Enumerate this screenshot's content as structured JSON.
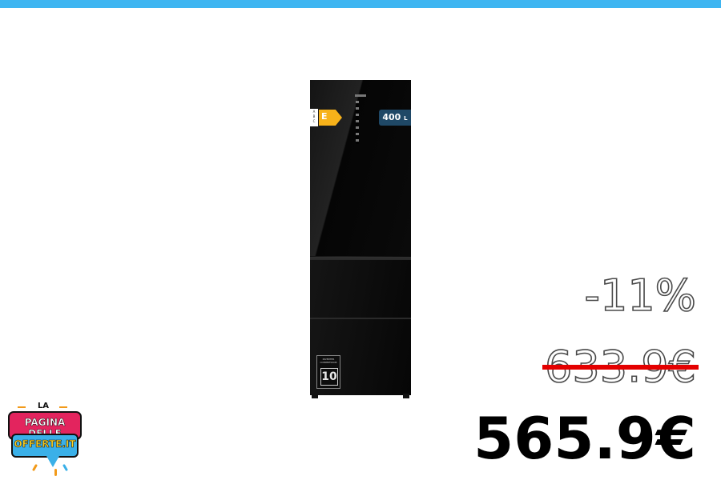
{
  "product": {
    "energy_classes": "A\nB\nC",
    "energy_class": "E",
    "capacity": "400",
    "capacity_unit": "L",
    "inverter_text": "INVERTER\nCOMPRESSOR",
    "inverter_years": "10"
  },
  "pricing": {
    "discount": "-11%",
    "old_price": "633.9€",
    "new_price": "565.9€"
  },
  "logo": {
    "top": "LA",
    "line1": "PAGINA DELLE",
    "line2": "OFFERTE.IT"
  },
  "colors": {
    "top_bar": "#3eb5f1",
    "strike": "#e40000",
    "energy_arrow": "#f7b21a",
    "logo_pink": "#e3245e",
    "logo_blue": "#3ab0e8"
  }
}
